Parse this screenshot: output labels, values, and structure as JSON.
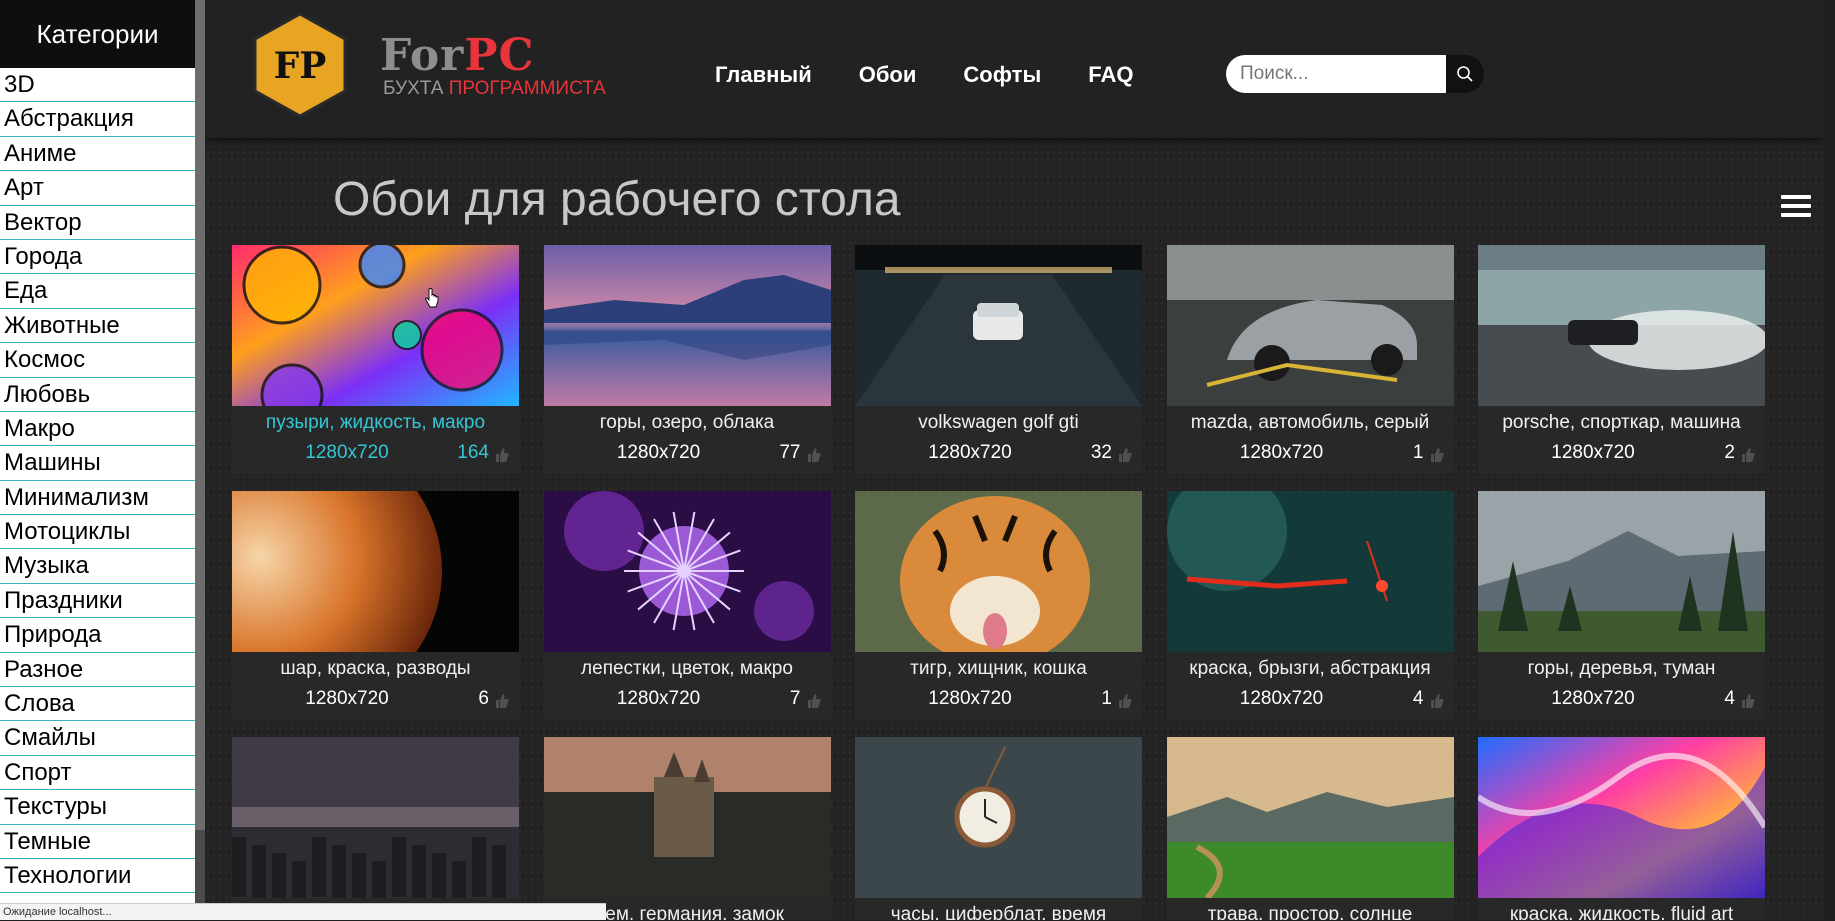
{
  "sidebar": {
    "title": "Категории",
    "items": [
      "3D",
      "Абстракция",
      "Аниме",
      "Арт",
      "Вектор",
      "Города",
      "Еда",
      "Животные",
      "Космос",
      "Любовь",
      "Макро",
      "Машины",
      "Минимализм",
      "Мотоциклы",
      "Музыка",
      "Праздники",
      "Природа",
      "Разное",
      "Слова",
      "Смайлы",
      "Спорт",
      "Текстуры",
      "Темные",
      "Технологии"
    ]
  },
  "header": {
    "logo": {
      "fp": "FP",
      "for": "For",
      "pc": "PC",
      "sub_a": "БУХТА ",
      "sub_b": "ПРОГРАММИСТА"
    },
    "nav": [
      "Главный",
      "Обои",
      "Софты",
      "FAQ"
    ],
    "search_placeholder": "Поиск..."
  },
  "page_title": "Обои для рабочего стола",
  "colors": {
    "accent": "#35c6d4",
    "brand_red": "#e8343a",
    "logo_hex": "#e7a523"
  },
  "wallpapers": [
    {
      "caption": "пузыри, жидкость, макро",
      "resolution": "1280x720",
      "likes": "164",
      "art": "bubbles"
    },
    {
      "caption": "горы, озеро, облака",
      "resolution": "1280x720",
      "likes": "77",
      "art": "lake"
    },
    {
      "caption": "volkswagen golf gti",
      "resolution": "1280x720",
      "likes": "32",
      "art": "garage"
    },
    {
      "caption": "mazda, автомобиль, серый",
      "resolution": "1280x720",
      "likes": "1",
      "art": "mazda"
    },
    {
      "caption": "porsche, спорткар, машина",
      "resolution": "1280x720",
      "likes": "2",
      "art": "drift"
    },
    {
      "caption": "шар, краска, разводы",
      "resolution": "1280x720",
      "likes": "6",
      "art": "planet"
    },
    {
      "caption": "лепестки, цветок, макро",
      "resolution": "1280x720",
      "likes": "7",
      "art": "flower"
    },
    {
      "caption": "тигр, хищник, кошка",
      "resolution": "1280x720",
      "likes": "1",
      "art": "tiger"
    },
    {
      "caption": "краска, брызги, абстракция",
      "resolution": "1280x720",
      "likes": "4",
      "art": "splash"
    },
    {
      "caption": "горы, деревья, туман",
      "resolution": "1280x720",
      "likes": "4",
      "art": "forest"
    },
    {
      "caption": "",
      "resolution": "",
      "likes": "",
      "art": "city"
    },
    {
      "caption": "шем, германия, замок",
      "resolution": "",
      "likes": "",
      "art": "castle"
    },
    {
      "caption": "часы, циферблат, время",
      "resolution": "",
      "likes": "",
      "art": "watch"
    },
    {
      "caption": "трава, простор, солнце",
      "resolution": "",
      "likes": "",
      "art": "field"
    },
    {
      "caption": "краска, жидкость, fluid art",
      "resolution": "",
      "likes": "",
      "art": "fluid"
    }
  ],
  "status_text": "Ожидание localhost..."
}
